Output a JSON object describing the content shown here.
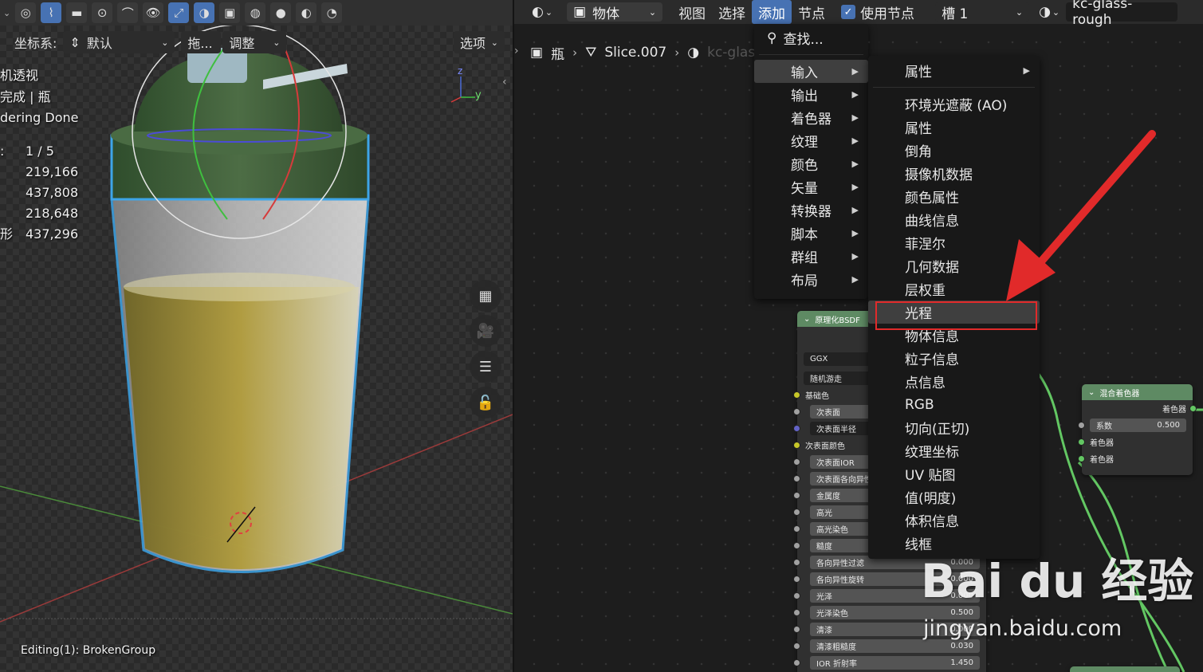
{
  "viewport": {
    "toolbar_chevron": "⌄",
    "header": {
      "coord_label": "坐标系:",
      "coord_value": "默认",
      "drag_label": "拖...",
      "adjust_label": "调整",
      "options_label": "选项"
    },
    "info_lines": [
      "机透视",
      "完成 | 瓶",
      "dering Done"
    ],
    "stats": [
      {
        "key": ":",
        "value": "1 / 5"
      },
      {
        "key": "",
        "value": "219,166"
      },
      {
        "key": "",
        "value": "437,808"
      },
      {
        "key": "",
        "value": "218,648"
      },
      {
        "key": "形",
        "value": "437,296"
      }
    ],
    "status": "Editing(1): BrokenGroup",
    "axis": {
      "z": "z",
      "y": "y"
    }
  },
  "node_editor": {
    "topbar": {
      "object_label": "物体",
      "menus": [
        "视图",
        "选择",
        "添加",
        "节点"
      ],
      "active_menu": "添加",
      "use_nodes_label": "使用节点",
      "slot_label": "槽 1",
      "material_name": "kc-glass-rough"
    },
    "breadcrumb": {
      "object": "瓶",
      "mesh": "Slice.007",
      "material": "kc-glass-rough"
    },
    "principled_node": {
      "title": "原理化BSDF",
      "distribution": "GGX",
      "subsurface_method": "随机游走",
      "rows": [
        {
          "label": "基础色",
          "value": "",
          "socket": "yellow",
          "type": "plain"
        },
        {
          "label": "次表面",
          "value": "",
          "socket": "grey",
          "type": "field"
        },
        {
          "label": "次表面半径",
          "value": "",
          "socket": "purple",
          "type": "field-dark"
        },
        {
          "label": "次表面颜色",
          "value": "",
          "socket": "yellow",
          "type": "plain"
        },
        {
          "label": "次表面IOR",
          "value": "",
          "socket": "grey",
          "type": "field"
        },
        {
          "label": "次表面各向异性",
          "value": "",
          "socket": "grey",
          "type": "field"
        },
        {
          "label": "金属度",
          "value": "",
          "socket": "grey",
          "type": "field"
        },
        {
          "label": "高光",
          "value": "",
          "socket": "grey",
          "type": "field"
        },
        {
          "label": "高光染色",
          "value": "",
          "socket": "grey",
          "type": "field"
        },
        {
          "label": "糙度",
          "value": "",
          "socket": "grey",
          "type": "field"
        },
        {
          "label": "各向异性过滤",
          "value": "0.000",
          "socket": "grey",
          "type": "field"
        },
        {
          "label": "各向异性旋转",
          "value": "0.000",
          "socket": "grey",
          "type": "field"
        },
        {
          "label": "光泽",
          "value": "0.000",
          "socket": "grey",
          "type": "field"
        },
        {
          "label": "光泽染色",
          "value": "0.500",
          "socket": "grey",
          "type": "field"
        },
        {
          "label": "清漆",
          "value": "0.000",
          "socket": "grey",
          "type": "field"
        },
        {
          "label": "清漆粗糙度",
          "value": "0.030",
          "socket": "grey",
          "type": "field"
        },
        {
          "label": "IOR 折射率",
          "value": "1.450",
          "socket": "grey",
          "type": "field"
        }
      ]
    },
    "mix_node": {
      "title": "混合着色器",
      "output_label": "着色器",
      "factor_label": "系数",
      "factor_value": "0.500",
      "input1": "着色器",
      "input2": "着色器"
    }
  },
  "add_menu": {
    "search_label": "查找...",
    "categories": [
      "输入",
      "输出",
      "着色器",
      "纹理",
      "颜色",
      "矢量",
      "转换器",
      "脚本",
      "群组",
      "布局"
    ],
    "active_category": "输入"
  },
  "input_submenu": {
    "items": [
      "属性",
      "环境光遮蔽 (AO)",
      "属性",
      "倒角",
      "摄像机数据",
      "颜色属性",
      "曲线信息",
      "菲涅尔",
      "几何数据",
      "层权重",
      "光程",
      "物体信息",
      "粒子信息",
      "点信息",
      "RGB",
      "切向(正切)",
      "纹理坐标",
      "UV 贴图",
      "值(明度)",
      "体积信息",
      "线框"
    ],
    "highlighted": "光程"
  },
  "watermark": {
    "brand": "Bai du 经验",
    "url": "jingyan.baidu.com"
  },
  "colors": {
    "accent": "#4772b3",
    "node_header": "#5e8a63",
    "annotation_red": "#e12a2a",
    "selection_outline": "#3da5e8"
  }
}
